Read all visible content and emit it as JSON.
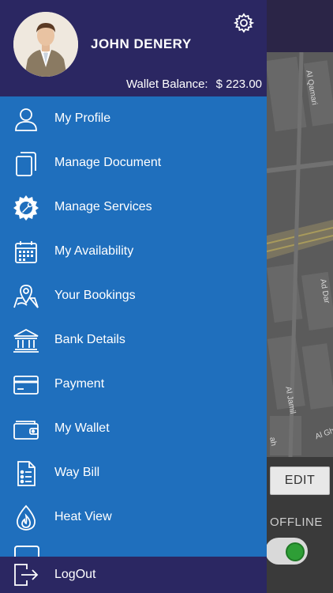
{
  "profile": {
    "name": "JOHN DENERY",
    "wallet_label": "Wallet Balance:",
    "wallet_amount": "$ 223.00"
  },
  "menu": {
    "items": [
      {
        "label": "My Profile",
        "icon": "user-icon"
      },
      {
        "label": "Manage Document",
        "icon": "documents-icon"
      },
      {
        "label": "Manage Services",
        "icon": "gear-wrench-icon"
      },
      {
        "label": "My Availability",
        "icon": "calendar-icon"
      },
      {
        "label": "Your Bookings",
        "icon": "map-pin-icon"
      },
      {
        "label": "Bank Details",
        "icon": "bank-icon"
      },
      {
        "label": "Payment",
        "icon": "credit-card-icon"
      },
      {
        "label": "My Wallet",
        "icon": "wallet-icon"
      },
      {
        "label": "Way Bill",
        "icon": "checklist-icon"
      },
      {
        "label": "Heat View",
        "icon": "flame-icon"
      }
    ],
    "logout_label": "LogOut"
  },
  "map": {
    "street_labels": [
      "Al Qamari",
      "Ad Dar",
      "Al Jamil",
      "Al Gh",
      "ah"
    ],
    "edit_label": "EDIT",
    "status_label": "OFFLINE"
  },
  "colors": {
    "header_bg": "#2b2762",
    "drawer_bg": "#1f6fbd",
    "toggle_on": "#2e9e36"
  }
}
